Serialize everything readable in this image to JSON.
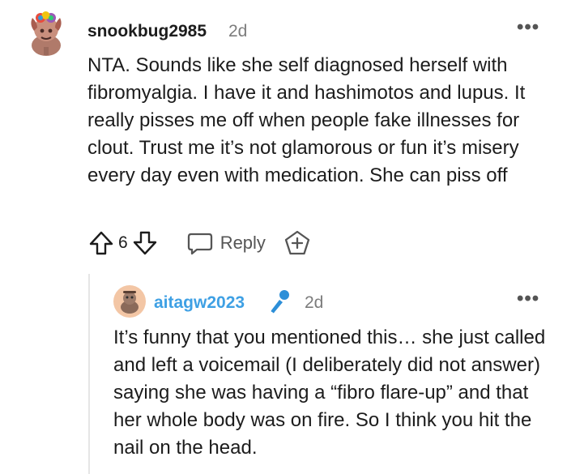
{
  "comment": {
    "author": "snookbug2985",
    "time": "2d",
    "more_label": "•••",
    "body": "NTA. Sounds like she self diagnosed herself with fibromyalgia. I have it and hashimotos and lupus. It really pisses me off when people fake illnesses for clout. Trust me it’s not glamorous or fun it’s misery every day even with medication. She can piss off",
    "score": "6",
    "reply_label": "Reply",
    "icons": [
      "avatar",
      "upvote-icon",
      "downvote-icon",
      "reply-icon",
      "award-icon",
      "more-icon"
    ]
  },
  "reply": {
    "author": "aitagw2023",
    "time": "2d",
    "more_label": "•••",
    "body": "It’s funny that you mentioned this… she just called and left a voicemail (I deliberately did not answer) saying she was having a “fibro flare-up” and that her whole body was on fire. So I think you hit the nail on the head.",
    "icons": [
      "avatar",
      "microphone-icon",
      "more-icon"
    ]
  },
  "colors": {
    "reply_author": "#3ea0e4",
    "mic_blue": "#2d8fd8",
    "muted": "#7c7c7c"
  }
}
